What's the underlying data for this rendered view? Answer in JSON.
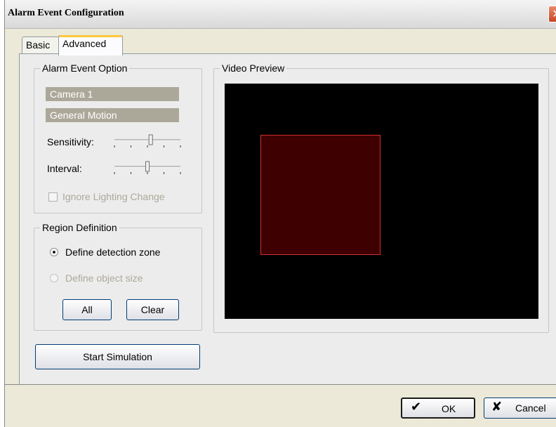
{
  "window": {
    "title": "Alarm Event Configuration",
    "close_glyph": "✕"
  },
  "tabs": [
    {
      "label": "Basic",
      "active": false
    },
    {
      "label": "Advanced",
      "active": true
    }
  ],
  "alarm_event_option": {
    "legend": "Alarm Event Option",
    "camera": "Camera 1",
    "event_type": "General Motion",
    "sensitivity_label": "Sensitivity:",
    "sensitivity_level": 0.55,
    "interval_label": "Interval:",
    "interval_level": 0.5,
    "ignore_lighting_label": "Ignore Lighting Change",
    "ignore_lighting_checked": false
  },
  "region_definition": {
    "legend": "Region Definition",
    "options": [
      {
        "label": "Define detection zone",
        "selected": true,
        "enabled": true
      },
      {
        "label": "Define object size",
        "selected": false,
        "enabled": false
      }
    ],
    "all_button": "All",
    "clear_button": "Clear"
  },
  "start_simulation_button": "Start Simulation",
  "video_preview": {
    "legend": "Video Preview",
    "zone_color": "#3e0000",
    "zone_border_color": "#d33030"
  },
  "footer": {
    "ok_label": "OK",
    "cancel_label": "Cancel",
    "ok_icon": "check-icon",
    "cancel_icon": "x-icon"
  }
}
